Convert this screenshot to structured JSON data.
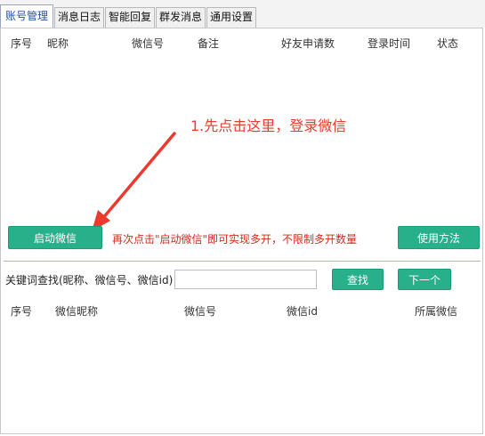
{
  "tabs": [
    {
      "label": "账号管理"
    },
    {
      "label": "消息日志"
    },
    {
      "label": "智能回复"
    },
    {
      "label": "群发消息"
    },
    {
      "label": "通用设置"
    }
  ],
  "account_table": {
    "columns": [
      "序号",
      "昵称",
      "微信号",
      "备注",
      "好友申请数",
      "登录时间",
      "状态"
    ],
    "rows": []
  },
  "annotation": "1.先点击这里，登录微信",
  "buttons": {
    "launch_wechat": "启动微信",
    "usage_guide": "使用方法",
    "search": "查找",
    "next": "下一个"
  },
  "hint": "再次点击\"启动微信\"即可实现多开，不限制多开数量",
  "search": {
    "label": "关键词查找(昵称、微信号、微信id)",
    "value": "",
    "placeholder": ""
  },
  "contacts_table": {
    "columns": [
      "序号",
      "微信昵称",
      "微信号",
      "微信id",
      "所属微信"
    ],
    "rows": []
  },
  "colors": {
    "accent_green": "#27b08a",
    "annotation_red": "#ea3b2e",
    "active_tab_text": "#2a4fa8"
  }
}
